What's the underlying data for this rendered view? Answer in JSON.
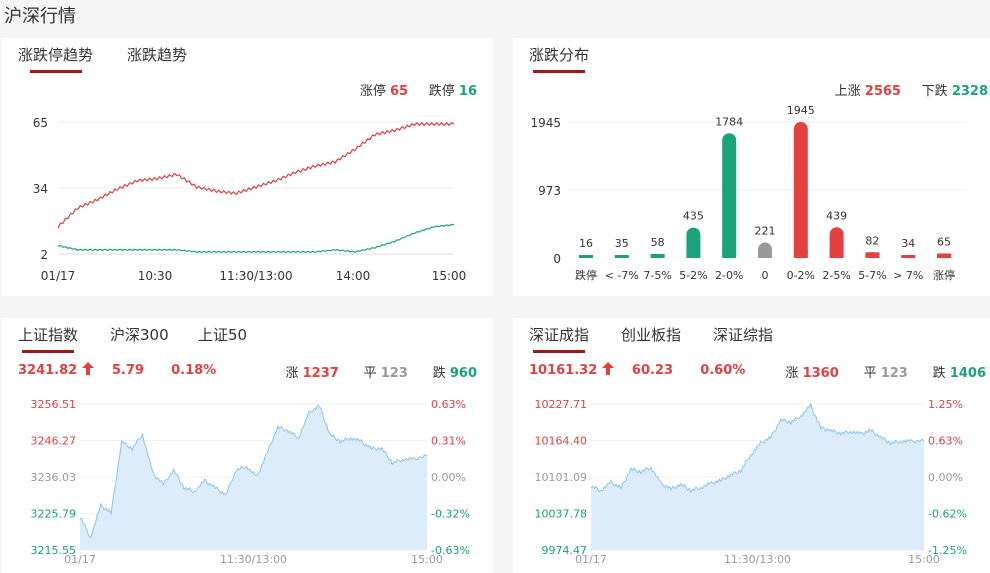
{
  "page_title": "沪深行情",
  "limit_trend": {
    "tabs": [
      "涨跌停趋势",
      "涨跌趋势"
    ],
    "legend": {
      "up_label": "涨停",
      "up_value": "65",
      "down_label": "跌停",
      "down_value": "16"
    },
    "colors": {
      "up": "#e34040",
      "down": "#1aa27a"
    }
  },
  "distribution": {
    "tab": "涨跌分布",
    "legend": {
      "up_label": "上涨",
      "up_value": "2565",
      "down_label": "下跌",
      "down_value": "2328"
    }
  },
  "sh_panel": {
    "tabs": [
      "上证指数",
      "沪深300",
      "上证50"
    ],
    "price": "3241.82",
    "change": "5.79",
    "pct": "0.18%",
    "up_label": "涨",
    "up_count": "1237",
    "flat_label": "平",
    "flat_count": "123",
    "down_label": "跌",
    "down_count": "960",
    "arrow_icon": "arrow-up-icon"
  },
  "sz_panel": {
    "tabs": [
      "深证成指",
      "创业板指",
      "深证综指"
    ],
    "price": "10161.32",
    "change": "60.23",
    "pct": "0.60%",
    "up_label": "涨",
    "up_count": "1360",
    "flat_label": "平",
    "flat_count": "123",
    "down_label": "跌",
    "down_count": "1406",
    "arrow_icon": "arrow-up-icon"
  },
  "chart_data": [
    {
      "type": "line",
      "y_ticks": [
        "65",
        "34",
        "2"
      ],
      "x_ticks": [
        "01/17",
        "10:30",
        "11:30/13:00",
        "14:00",
        "15:00"
      ],
      "ylim": [
        2,
        65
      ],
      "series": [
        {
          "name": "涨停",
          "x": [
            0,
            0.05,
            0.1,
            0.15,
            0.2,
            0.25,
            0.3,
            0.35,
            0.4,
            0.45,
            0.5,
            0.55,
            0.6,
            0.65,
            0.7,
            0.75,
            0.8,
            0.85,
            0.9,
            0.95,
            1.0
          ],
          "values": [
            15,
            24,
            28,
            33,
            37,
            38,
            40,
            34,
            32,
            31,
            34,
            37,
            41,
            44,
            46,
            52,
            59,
            61,
            64,
            64,
            64
          ]
        },
        {
          "name": "跌停",
          "x": [
            0,
            0.05,
            0.1,
            0.15,
            0.2,
            0.25,
            0.3,
            0.35,
            0.4,
            0.45,
            0.5,
            0.55,
            0.6,
            0.65,
            0.7,
            0.75,
            0.8,
            0.85,
            0.9,
            0.95,
            1.0
          ],
          "values": [
            6,
            4,
            4,
            4,
            4,
            4,
            4,
            3,
            3,
            3,
            3,
            3,
            3,
            3,
            4,
            3,
            5,
            8,
            12,
            15,
            16
          ]
        }
      ]
    },
    {
      "type": "bar",
      "y_ticks": [
        "1945",
        "973",
        "0"
      ],
      "categories": [
        "跌停",
        "< -7%",
        "7-5%",
        "5-2%",
        "2-0%",
        "0",
        "0-2%",
        "2-5%",
        "5-7%",
        "> 7%",
        "涨停"
      ],
      "values": [
        16,
        35,
        58,
        435,
        1784,
        221,
        1945,
        439,
        82,
        34,
        65
      ],
      "value_labels": [
        "16",
        "35",
        "58",
        "435",
        "1784",
        "221",
        "1945",
        "439",
        "82",
        "34",
        "65"
      ],
      "colors": [
        "#1aa27a",
        "#1aa27a",
        "#1aa27a",
        "#1aa27a",
        "#1aa27a",
        "#999999",
        "#e34040",
        "#e34040",
        "#e34040",
        "#e34040",
        "#e34040"
      ],
      "ylim": [
        0,
        1945
      ]
    },
    {
      "type": "area",
      "y_ticks": [
        "3256.51",
        "3246.27",
        "3236.03",
        "3225.79",
        "3215.55"
      ],
      "pct_ticks": [
        "0.63%",
        "0.31%",
        "0.00%",
        "-0.32%",
        "-0.63%"
      ],
      "x_ticks": [
        "01/17",
        "11:30/13:00",
        "15:00"
      ],
      "ylim": [
        3215.55,
        3256.51
      ],
      "x": [
        0,
        0.03,
        0.06,
        0.09,
        0.12,
        0.15,
        0.18,
        0.21,
        0.24,
        0.27,
        0.3,
        0.33,
        0.36,
        0.39,
        0.42,
        0.45,
        0.48,
        0.51,
        0.54,
        0.57,
        0.6,
        0.63,
        0.66,
        0.69,
        0.72,
        0.75,
        0.78,
        0.81,
        0.84,
        0.87,
        0.9,
        0.93,
        0.96,
        1.0
      ],
      "values": [
        3225,
        3219,
        3228,
        3226,
        3246,
        3244,
        3248,
        3237,
        3234,
        3238,
        3233,
        3232,
        3235,
        3233,
        3231,
        3238,
        3239,
        3236,
        3243,
        3250,
        3249,
        3247,
        3254,
        3256,
        3248,
        3246,
        3247,
        3246,
        3244,
        3244,
        3240,
        3241,
        3241,
        3242
      ]
    },
    {
      "type": "area",
      "y_ticks": [
        "10227.71",
        "10164.40",
        "10101.09",
        "10037.78",
        "9974.47"
      ],
      "pct_ticks": [
        "1.25%",
        "0.63%",
        "0.00%",
        "-0.62%",
        "-1.25%"
      ],
      "x_ticks": [
        "01/17",
        "11:30/13:00",
        "15:00"
      ],
      "ylim": [
        9974.47,
        10227.71
      ],
      "x": [
        0,
        0.03,
        0.06,
        0.09,
        0.12,
        0.15,
        0.18,
        0.21,
        0.24,
        0.27,
        0.3,
        0.33,
        0.36,
        0.39,
        0.42,
        0.45,
        0.48,
        0.51,
        0.54,
        0.57,
        0.6,
        0.63,
        0.66,
        0.69,
        0.72,
        0.75,
        0.78,
        0.81,
        0.84,
        0.87,
        0.9,
        0.93,
        0.96,
        1.0
      ],
      "values": [
        10085,
        10078,
        10092,
        10082,
        10115,
        10110,
        10118,
        10090,
        10080,
        10088,
        10078,
        10083,
        10090,
        10095,
        10105,
        10112,
        10140,
        10160,
        10170,
        10200,
        10196,
        10207,
        10225,
        10186,
        10182,
        10177,
        10180,
        10176,
        10182,
        10170,
        10160,
        10163,
        10163,
        10164
      ]
    }
  ]
}
